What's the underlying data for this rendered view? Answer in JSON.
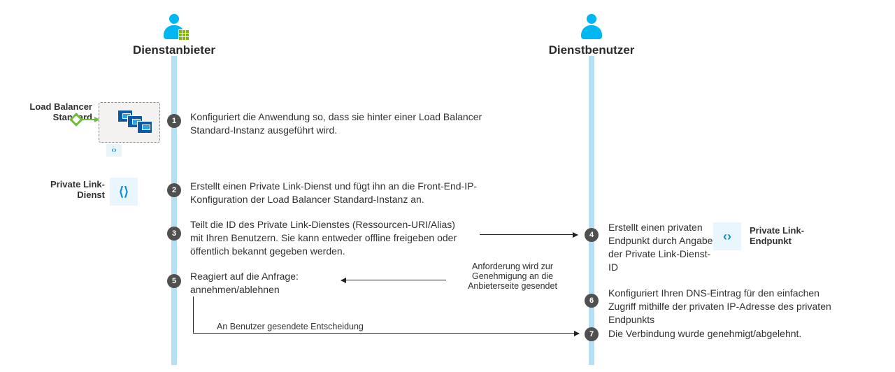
{
  "actors": {
    "provider": "Dienstanbieter",
    "consumer": "Dienstbenutzer"
  },
  "side_labels": {
    "lb": "Load Balancer Standard",
    "pls": "Private Link-Dienst",
    "ple": "Private Link-Endpunkt"
  },
  "steps": {
    "s1": {
      "n": "1",
      "text": "Konfiguriert die Anwendung so, dass sie hinter einer Load Balancer Standard-Instanz ausgeführt wird."
    },
    "s2": {
      "n": "2",
      "text": "Erstellt einen Private Link-Dienst und fügt ihn an die Front-End-IP-Konfiguration der Load Balancer Standard-Instanz an."
    },
    "s3": {
      "n": "3",
      "text": "Teilt die ID des Private Link-Dienstes (Ressourcen-URI/Alias) mit Ihren Benutzern. Sie kann entweder offline freigeben oder öffentlich bekannt gegeben werden."
    },
    "s4": {
      "n": "4",
      "text": "Erstellt einen privaten Endpunkt durch Angabe der Private Link-Dienst-ID"
    },
    "s5": {
      "n": "5",
      "text": "Reagiert auf die Anfrage: annehmen/ablehnen"
    },
    "s6": {
      "n": "6",
      "text": "Konfiguriert Ihren DNS-Eintrag für den einfachen Zugriff mithilfe der privaten IP-Adresse des privaten Endpunkts"
    },
    "s7": {
      "n": "7",
      "text": "Die Verbindung wurde genehmigt/abgelehnt."
    }
  },
  "arrow_notes": {
    "approval_request": "Anforderung wird zur Genehmigung an die Anbieterseite gesendet",
    "decision_sent": "An Benutzer gesendete Entscheidung"
  },
  "icons": {
    "link_glyph": "⟨⟩",
    "endpoint_glyph": "‹›"
  }
}
